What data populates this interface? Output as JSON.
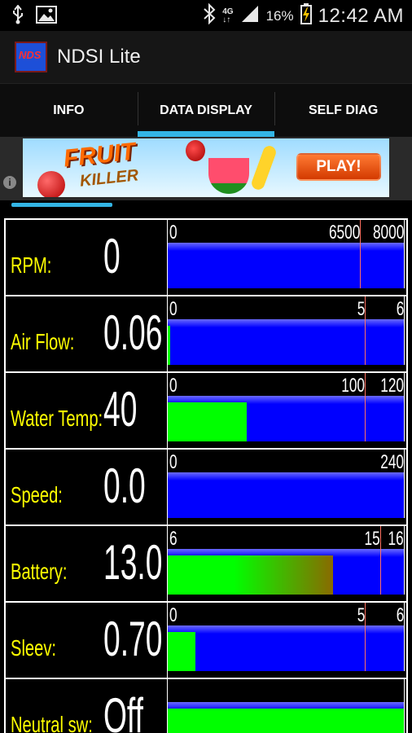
{
  "status_bar": {
    "icons": [
      "usb-icon",
      "image-icon",
      "bluetooth-icon",
      "4g-network-icon",
      "signal-icon",
      "battery-charging-icon"
    ],
    "network_type": "4G",
    "battery_percent": "16%",
    "time": "12:42 AM"
  },
  "app": {
    "logo_text": "NDS",
    "title": "NDSI Lite"
  },
  "tabs": [
    {
      "label": "INFO",
      "active": false
    },
    {
      "label": "DATA DISPLAY",
      "active": true
    },
    {
      "label": "SELF DIAG",
      "active": false
    }
  ],
  "ad": {
    "title_line1": "FRUIT",
    "title_line2": "KILLER",
    "cta": "PLAY!",
    "info_glyph": "i"
  },
  "loading_progress": 0.26,
  "colors": {
    "label": "#ffff00",
    "value": "#ffffff",
    "track": "#0000ff",
    "fill_green": "#00ff00",
    "redline": "#ff7060",
    "tab_indicator": "#33b5e5"
  },
  "gauges": [
    {
      "label": "RPM:",
      "value": "0",
      "min": 0,
      "max": 8000,
      "redline": 6500,
      "reading": 0,
      "scale_labels": [
        "0",
        "6500",
        "8000"
      ],
      "fill_style": "none"
    },
    {
      "label": "Air Flow:",
      "value": "0.06",
      "min": 0,
      "max": 6,
      "redline": 5,
      "reading": 0.06,
      "scale_labels": [
        "0",
        "5",
        "6"
      ],
      "fill_style": "solid"
    },
    {
      "label": "Water Temp:",
      "value": "40",
      "min": 0,
      "max": 120,
      "redline": 100,
      "reading": 40,
      "scale_labels": [
        "0",
        "100",
        "120"
      ],
      "fill_style": "solid"
    },
    {
      "label": "Speed:",
      "value": "0.0",
      "min": 0,
      "max": 240,
      "redline": null,
      "reading": 0,
      "scale_labels": [
        "0",
        "240"
      ],
      "fill_style": "none"
    },
    {
      "label": "Battery:",
      "value": "13.0",
      "min": 6,
      "max": 16,
      "redline": 15,
      "reading": 13.0,
      "scale_labels": [
        "6",
        "15",
        "16"
      ],
      "fill_style": "gradient"
    },
    {
      "label": "Sleev:",
      "value": "0.70",
      "min": 0,
      "max": 6,
      "redline": 5,
      "reading": 0.7,
      "scale_labels": [
        "0",
        "5",
        "6"
      ],
      "fill_style": "solid"
    },
    {
      "label": "Neutral sw:",
      "value": "Off",
      "min": 0,
      "max": 1,
      "redline": null,
      "reading": 1,
      "scale_labels": [],
      "fill_style": "solid"
    }
  ]
}
